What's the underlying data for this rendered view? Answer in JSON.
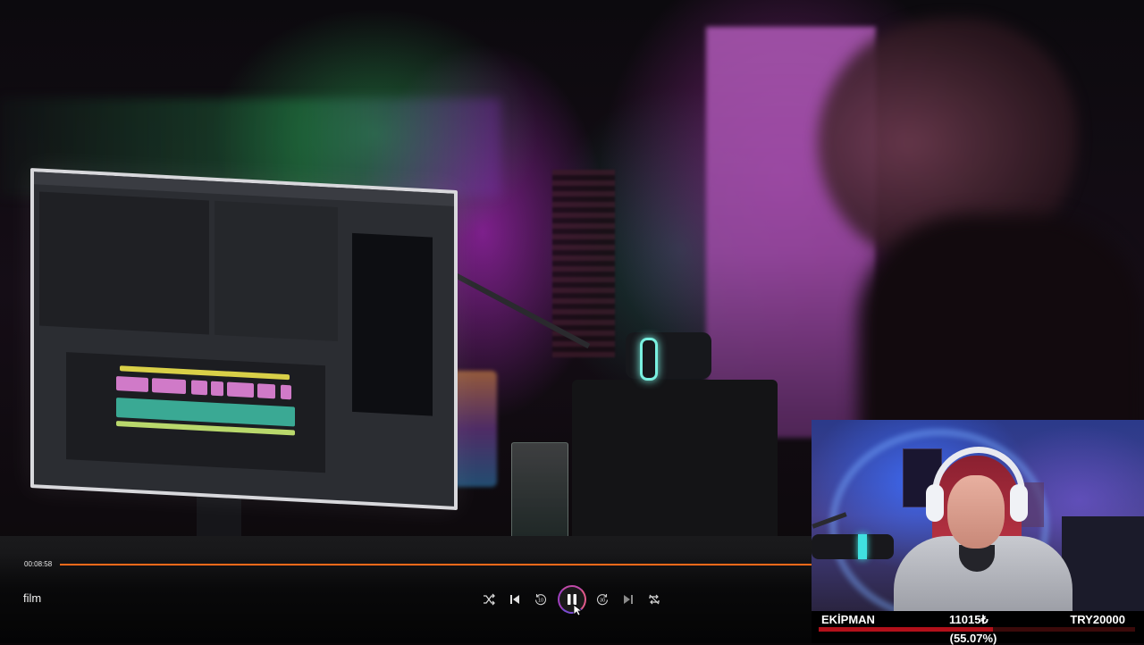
{
  "player": {
    "title": "film",
    "elapsed": "00:08:58",
    "progress_fraction": 1.0,
    "accent_color": "#ff6a1a",
    "controls": [
      {
        "name": "shuffle-icon"
      },
      {
        "name": "skip-previous-icon"
      },
      {
        "name": "rewind-10-icon",
        "label": "10"
      },
      {
        "name": "pause-icon"
      },
      {
        "name": "forward-30-icon",
        "label": "30"
      },
      {
        "name": "skip-next-icon"
      },
      {
        "name": "repeat-off-icon"
      }
    ]
  },
  "goal": {
    "label": "EKİPMAN",
    "current": "11015₺",
    "target": "TRY20000",
    "percent_text": "(55.07%)",
    "progress_fraction": 0.5507,
    "bar_color": "#b2101a"
  }
}
